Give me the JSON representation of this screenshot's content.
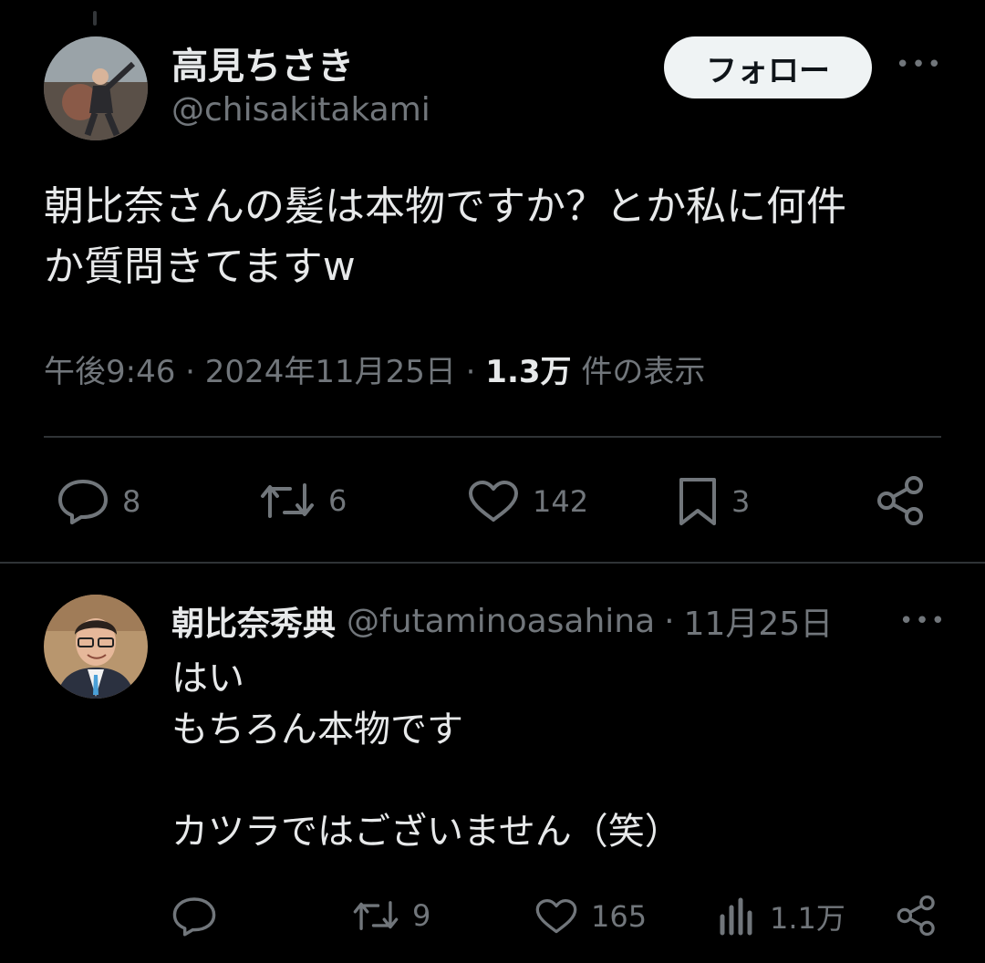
{
  "main_tweet": {
    "author_name": "高見ちさき",
    "author_handle": "@chisakitakami",
    "follow_label": "フォロー",
    "more_label": "•••",
    "text": "朝比奈さんの髪は本物ですか？とか私に何件\nか質問きてますw",
    "time": "午後9:46",
    "date": "2024年11月25日",
    "separator": "·",
    "views_count": "1.3万",
    "views_label": "件の表示",
    "actions": {
      "replies": "8",
      "reposts": "6",
      "likes": "142",
      "bookmarks": "3"
    },
    "icons": [
      "reply-icon",
      "repost-icon",
      "like-icon",
      "bookmark-icon",
      "share-icon"
    ]
  },
  "reply_tweet": {
    "author_name": "朝比奈秀典",
    "author_handle": "@futaminoasahina",
    "separator": "·",
    "date": "11月25日",
    "more_label": "•••",
    "text": "はい\nもちろん本物です\n\nカツラではございません（笑）",
    "actions": {
      "replies": "",
      "reposts": "9",
      "likes": "165",
      "views": "1.1万"
    },
    "icons": [
      "reply-icon",
      "repost-icon",
      "like-icon",
      "views-icon",
      "share-icon"
    ]
  },
  "colors": {
    "background": "#000000",
    "text": "#e7e9ea",
    "muted": "#71767b",
    "divider": "#2f3336",
    "follow_button_bg": "#eff3f4"
  }
}
